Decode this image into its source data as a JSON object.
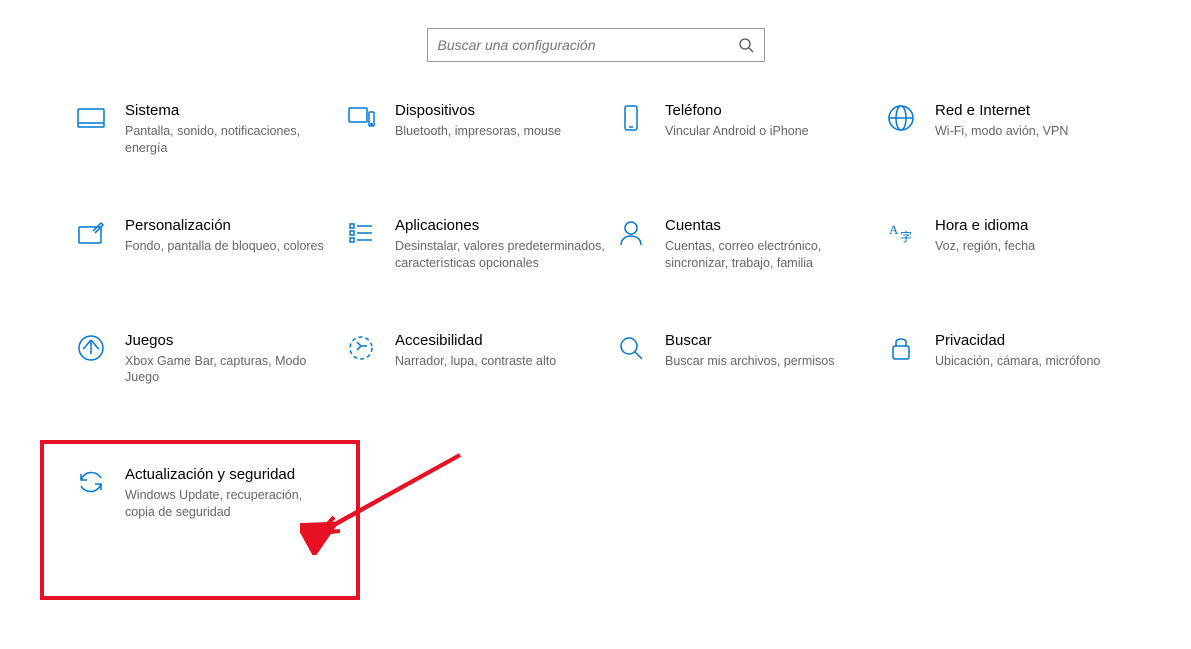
{
  "search": {
    "placeholder": "Buscar una configuración"
  },
  "tiles": [
    {
      "title": "Sistema",
      "desc": "Pantalla, sonido, notificaciones, energía"
    },
    {
      "title": "Dispositivos",
      "desc": "Bluetooth, impresoras, mouse"
    },
    {
      "title": "Teléfono",
      "desc": "Vincular Android o iPhone"
    },
    {
      "title": "Red e Internet",
      "desc": "Wi-Fi, modo avión, VPN"
    },
    {
      "title": "Personalización",
      "desc": "Fondo, pantalla de bloqueo, colores"
    },
    {
      "title": "Aplicaciones",
      "desc": "Desinstalar, valores predeterminados, características opcionales"
    },
    {
      "title": "Cuentas",
      "desc": "Cuentas, correo electrónico, sincronizar, trabajo, familia"
    },
    {
      "title": "Hora e idioma",
      "desc": "Voz, región, fecha"
    },
    {
      "title": "Juegos",
      "desc": "Xbox Game Bar, capturas, Modo Juego"
    },
    {
      "title": "Accesibilidad",
      "desc": "Narrador, lupa, contraste alto"
    },
    {
      "title": "Buscar",
      "desc": "Buscar mis archivos, permisos"
    },
    {
      "title": "Privacidad",
      "desc": "Ubicación, cámara, micrófono"
    },
    {
      "title": "Actualización y seguridad",
      "desc": "Windows Update, recuperación, copia de seguridad"
    }
  ],
  "colors": {
    "accent": "#0078d7",
    "annotation": "#e81123"
  }
}
